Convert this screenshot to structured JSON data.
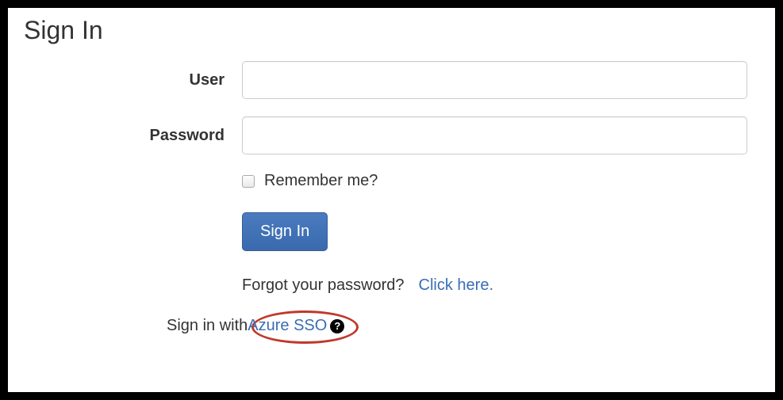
{
  "page": {
    "title": "Sign In"
  },
  "form": {
    "user_label": "User",
    "user_value": "",
    "password_label": "Password",
    "password_value": "",
    "remember_label": "Remember me?",
    "submit_label": "Sign In"
  },
  "forgot": {
    "prompt": "Forgot your password?",
    "link_label": "Click here."
  },
  "sso": {
    "prefix": "Sign in with ",
    "link_label": "Azure SSO",
    "help_glyph": "?"
  }
}
